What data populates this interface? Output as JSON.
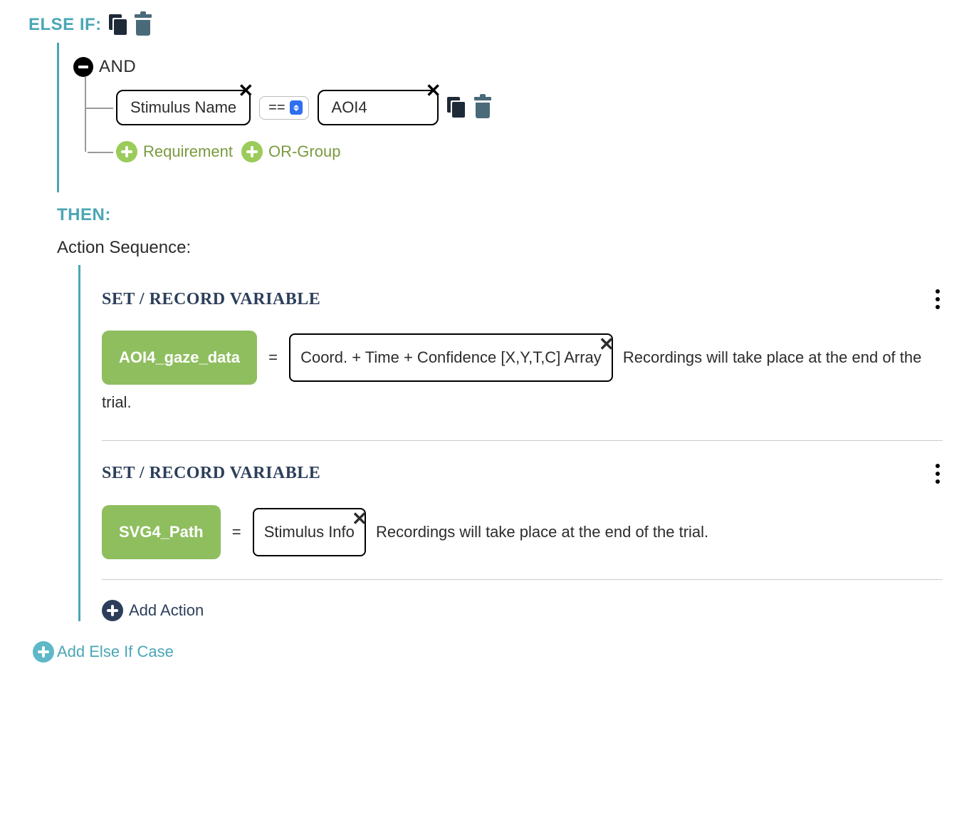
{
  "elseif": {
    "label": "ELSE IF:"
  },
  "condition": {
    "operator": "AND",
    "rows": [
      {
        "left": "Stimulus Name",
        "cmp": "==",
        "right": "AOI4"
      }
    ],
    "add_requirement": "Requirement",
    "add_orgroup": "OR-Group"
  },
  "then": {
    "label": "THEN:",
    "sequence_label": "Action Sequence:"
  },
  "actions": [
    {
      "title": "SET / RECORD VARIABLE",
      "var": "AOI4_gaze_data",
      "eq": "=",
      "value": "Coord. + Time + Confidence [X,Y,T,C] Array",
      "trail": "Recordings will take place at the end of the trial."
    },
    {
      "title": "SET / RECORD VARIABLE",
      "var": "SVG4_Path",
      "eq": "=",
      "value": "Stimulus Info",
      "trail": "Recordings will take place at the end of the trial."
    }
  ],
  "add_action": "Add Action",
  "add_elseif": "Add Else If Case"
}
